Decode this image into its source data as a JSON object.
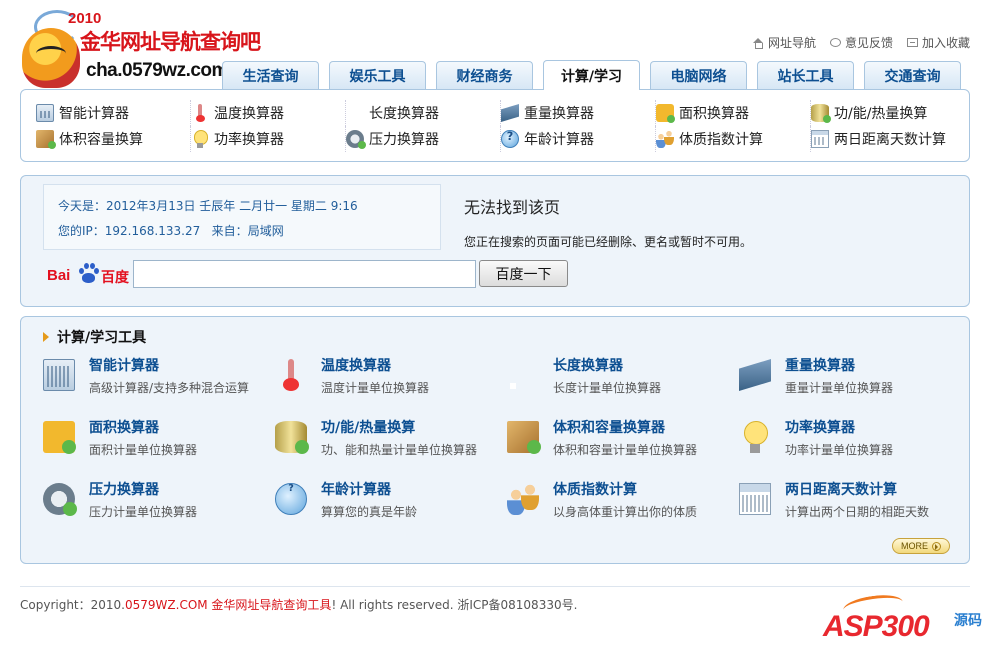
{
  "logo": {
    "year": "2010",
    "title": "金华网址导航查询吧",
    "domain": "cha.0579wz.com"
  },
  "top_links": [
    {
      "label": "网址导航",
      "icon": "home-icon"
    },
    {
      "label": "意见反馈",
      "icon": "feedback-icon"
    },
    {
      "label": "加入收藏",
      "icon": "bookmark-icon"
    }
  ],
  "tabs": [
    {
      "label": "生活查询",
      "active": false
    },
    {
      "label": "娱乐工具",
      "active": false
    },
    {
      "label": "财经商务",
      "active": false
    },
    {
      "label": "计算/学习",
      "active": true
    },
    {
      "label": "电脑网络",
      "active": false
    },
    {
      "label": "站长工具",
      "active": false
    },
    {
      "label": "交通查询",
      "active": false
    }
  ],
  "quick_tools": [
    {
      "label": "智能计算器",
      "icon": "calculator-icon"
    },
    {
      "label": "温度换算器",
      "icon": "thermometer-icon"
    },
    {
      "label": "长度换算器",
      "icon": "ruler-icon"
    },
    {
      "label": "重量换算器",
      "icon": "steel-beam-icon"
    },
    {
      "label": "面积换算器",
      "icon": "puzzle-icon"
    },
    {
      "label": "功/能/热量换算",
      "icon": "cylinder-icon"
    },
    {
      "label": "体积容量换算",
      "icon": "box-icon"
    },
    {
      "label": "功率换算器",
      "icon": "lightbulb-icon"
    },
    {
      "label": "压力换算器",
      "icon": "pressure-gauge-icon"
    },
    {
      "label": "年龄计算器",
      "icon": "help-icon"
    },
    {
      "label": "体质指数计算",
      "icon": "people-icon"
    },
    {
      "label": "两日距离天数计算",
      "icon": "calendar-icon"
    }
  ],
  "info": {
    "date_label": "今天是：",
    "date_value": "2012年3月13日 壬辰年 二月廿一 星期二 9:16",
    "ip_label": "您的IP：",
    "ip_value": "192.168.133.27",
    "source_label": "来自：",
    "source_value": "局域网",
    "notfound_title": "无法找到该页",
    "notfound_text": "您正在搜索的页面可能已经删除、更名或暂时不可用。"
  },
  "search": {
    "logo_bai": "Bai",
    "logo_du": "百度",
    "value": "",
    "button_label": "百度一下"
  },
  "tools_section": {
    "title": "计算/学习工具",
    "more_label": "MORE",
    "items": [
      {
        "name": "智能计算器",
        "desc": "高级计算器/支持多种混合运算",
        "icon": "calculator-icon"
      },
      {
        "name": "温度换算器",
        "desc": "温度计量单位换算器",
        "icon": "thermometer-icon"
      },
      {
        "name": "长度换算器",
        "desc": "长度计量单位换算器",
        "icon": "ruler-icon"
      },
      {
        "name": "重量换算器",
        "desc": "重量计量单位换算器",
        "icon": "steel-beam-icon"
      },
      {
        "name": "面积换算器",
        "desc": "面积计量单位换算器",
        "icon": "puzzle-icon"
      },
      {
        "name": "功/能/热量换算",
        "desc": "功、能和热量计量单位换算器",
        "icon": "cylinder-icon"
      },
      {
        "name": "体积和容量换算器",
        "desc": "体积和容量计量单位换算器",
        "icon": "box-icon"
      },
      {
        "name": "功率换算器",
        "desc": "功率计量单位换算器",
        "icon": "lightbulb-icon"
      },
      {
        "name": "压力换算器",
        "desc": "压力计量单位换算器",
        "icon": "pressure-gauge-icon"
      },
      {
        "name": "年龄计算器",
        "desc": "算算您的真是年龄",
        "icon": "help-icon"
      },
      {
        "name": "体质指数计算",
        "desc": "以身高体重计算出你的体质",
        "icon": "people-icon"
      },
      {
        "name": "两日距离天数计算",
        "desc": "计算出两个日期的相距天数",
        "icon": "calendar-icon"
      }
    ]
  },
  "footer": {
    "prefix": "Copyright：2010.",
    "site": "0579WZ.COM 金华网址导航查询工具",
    "suffix": "! All rights reserved. 浙ICP备08108330号."
  },
  "watermark": {
    "brand": "ASP300",
    "suffix": "源码"
  },
  "colors": {
    "accent_blue": "#0d4f91",
    "border_blue": "#a9c6e0",
    "panel_bg": "#eef4fa",
    "brand_red": "#d8151b"
  }
}
